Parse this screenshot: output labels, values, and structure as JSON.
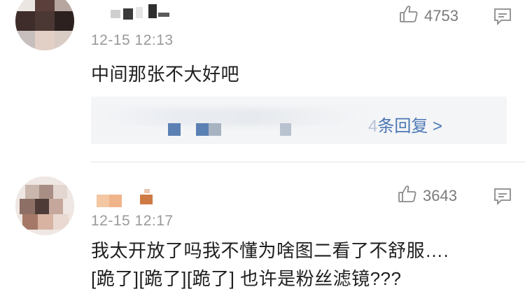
{
  "comments": [
    {
      "username": "",
      "time": "12-15 12:13",
      "likes": "4753",
      "text_lines": [
        "中间那张不大好吧"
      ],
      "replies_prefix": "4",
      "replies_label": "条回复 >"
    },
    {
      "username": "",
      "time": "12-15 12:17",
      "likes": "3643",
      "text_lines": [
        "我太开放了吗我不懂为啥图二看了不舒服….",
        "[跪了][跪了][跪了] 也许是粉丝滤镜???"
      ]
    }
  ],
  "colors": {
    "text": "#1f1f1f",
    "meta": "#9a9a9a",
    "link": "#4b78b4",
    "reply_bg": "#f4f5f7"
  },
  "icons": [
    "thumb-up-icon",
    "comment-icon",
    "avatar-pixelated"
  ]
}
